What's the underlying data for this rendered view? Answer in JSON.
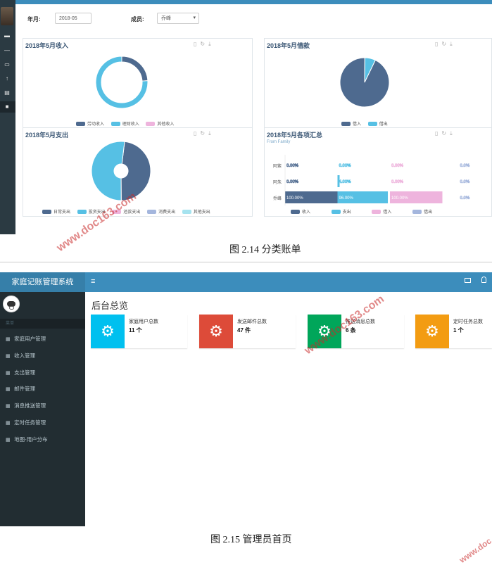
{
  "figure1": {
    "filter": {
      "year_month_label": "年月:",
      "year_month_value": "2018-05",
      "member_label": "成员:",
      "member_value": "乔峰",
      "member_arrow": "▾"
    },
    "sidebar_icons": [
      "id-card-icon",
      "minus-icon",
      "credit-card-icon",
      "upload-icon",
      "book-icon",
      "folder-icon"
    ],
    "toolbar_icons": [
      "document-icon",
      "refresh-icon",
      "download-icon"
    ],
    "income_chart": {
      "title": "2018年5月收入",
      "type": "pie",
      "categories": [
        "劳动收入",
        "理财收入",
        "其他收入"
      ],
      "values": [
        24,
        76,
        0
      ],
      "colors": [
        "#4e6a8f",
        "#56c0e4",
        "#eeb4dd"
      ]
    },
    "loan_chart": {
      "title": "2018年5月借款",
      "type": "pie",
      "categories": [
        "借入",
        "借出"
      ],
      "values": [
        93,
        7
      ],
      "colors": [
        "#4e6a8f",
        "#56c0e4"
      ]
    },
    "expense_chart": {
      "title": "2018年5月支出",
      "type": "pie",
      "categories": [
        "日常支出",
        "投资支出",
        "还款支出",
        "消费支出",
        "其他支出"
      ],
      "values": [
        48,
        52,
        0,
        0,
        0
      ],
      "colors": [
        "#4e6a8f",
        "#56c0e4",
        "#eeb4dd",
        "#a4b6dd",
        "#a6e3ef"
      ]
    },
    "summary_chart": {
      "title": "2018年5月各项汇总",
      "subtitle": "From Family",
      "type": "bar",
      "categories": [
        "阿紫",
        "阿朱",
        "乔峰"
      ],
      "series_names": [
        "收入",
        "支出",
        "借入",
        "借出"
      ],
      "colors": [
        "#4e6a8f",
        "#56c0e4",
        "#eeb4dd",
        "#a4b6dd"
      ],
      "labels": [
        [
          "0.00%",
          "0.00%",
          "0.00%",
          "0.0%"
        ],
        [
          "0.00%",
          "4.00%",
          "0.00%",
          "0.0%"
        ],
        [
          "100.00%",
          "96.00%",
          "100.00%",
          "0.0%"
        ]
      ],
      "values": [
        [
          0,
          0,
          0,
          0
        ],
        [
          0,
          4,
          0,
          0
        ],
        [
          100,
          96,
          100,
          0
        ]
      ]
    },
    "caption": "图 2.14 分类账单",
    "watermark": "www.doc163.com"
  },
  "figure2": {
    "brand": "家庭记账管理系统",
    "menu_toggle": "≡",
    "header_icons": [
      "mail-icon",
      "bell-icon"
    ],
    "nav_header": "菜单",
    "menu": [
      "家庭用户管理",
      "收入管理",
      "支出管理",
      "邮件管理",
      "消息推送管理",
      "定时任务管理",
      "地图-用户分布"
    ],
    "page_title": "后台总览",
    "boxes": [
      {
        "label": "家庭用户总数",
        "value": "11 个",
        "color": "#00c0ef"
      },
      {
        "label": "发送邮件总数",
        "value": "47 件",
        "color": "#dd4b39"
      },
      {
        "label": "推送消息总数",
        "value": "6 条",
        "color": "#00a65a"
      },
      {
        "label": "定时任务总数",
        "value": "1 个",
        "color": "#f39c12"
      }
    ],
    "gear_glyph": "⚙",
    "caption": "图 2.15  管理员首页",
    "watermark": "www.doc163.com",
    "corner_watermark": "www.doc"
  }
}
